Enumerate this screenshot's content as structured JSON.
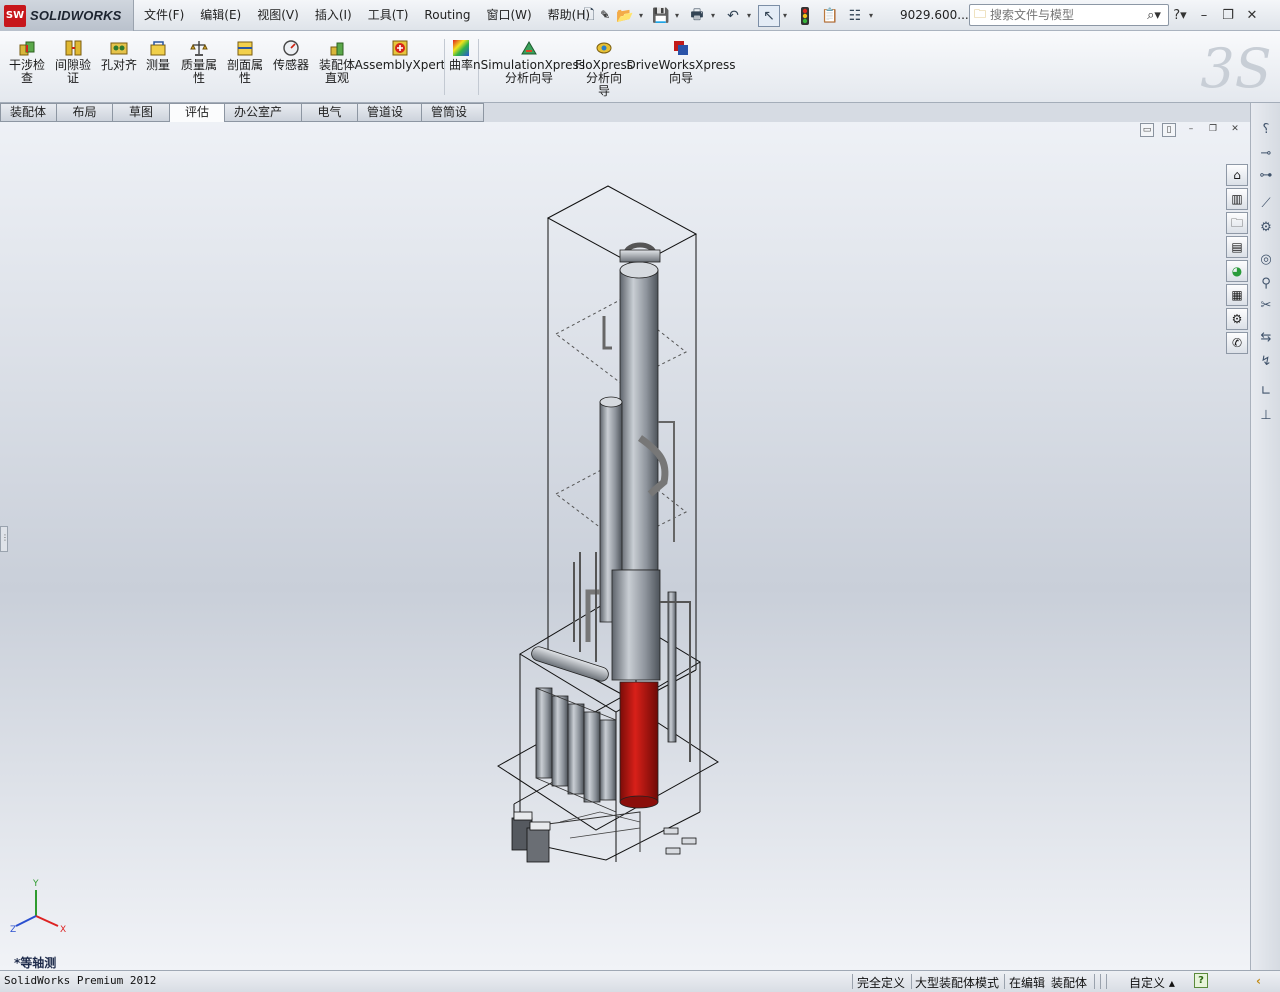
{
  "app": {
    "brand": "SOLIDWORKS",
    "brand_badge": "SW",
    "file_label": "9029.600...",
    "status_product": "SolidWorks Premium 2012"
  },
  "menu": [
    "文件(F)",
    "编辑(E)",
    "视图(V)",
    "插入(I)",
    "工具(T)",
    "Routing",
    "窗口(W)",
    "帮助(H)"
  ],
  "search": {
    "placeholder": "搜索文件与模型"
  },
  "ribbon": {
    "buttons": [
      {
        "label": "干涉检\n查",
        "icon": "interference-check-icon"
      },
      {
        "label": "间隙验\n证",
        "icon": "clearance-verification-icon"
      },
      {
        "label": "孔对齐",
        "icon": "hole-alignment-icon"
      },
      {
        "label": "测量",
        "icon": "measure-icon"
      },
      {
        "label": "质量属\n性",
        "icon": "mass-properties-icon"
      },
      {
        "label": "剖面属\n性",
        "icon": "section-properties-icon"
      },
      {
        "label": "传感器",
        "icon": "sensor-icon"
      },
      {
        "label": "装配体\n直观",
        "icon": "assembly-visualization-icon"
      },
      {
        "label": "AssemblyXpert",
        "icon": "assemblyxpert-icon"
      },
      {
        "label": "曲率",
        "icon": "curvature-icon"
      },
      {
        "label": "nSimulationXpress\n分析向导",
        "icon": "simulationxpress-icon"
      },
      {
        "label": "FloXpress\n分析向\n导",
        "icon": "floxpress-icon"
      },
      {
        "label": "DriveWorksXpress\n向导",
        "icon": "driveworksxpress-icon"
      }
    ]
  },
  "tabs": [
    {
      "label": "装配体",
      "active": false
    },
    {
      "label": "布局",
      "active": false
    },
    {
      "label": "草图",
      "active": false
    },
    {
      "label": "评估",
      "active": true
    },
    {
      "label": "办公室产品",
      "active": false
    },
    {
      "label": "电气",
      "active": false
    },
    {
      "label": "管道设计",
      "active": false
    },
    {
      "label": "管筒设计",
      "active": false
    }
  ],
  "viewport": {
    "view_name": "*等轴测",
    "triad_labels": {
      "x": "X",
      "y": "Y",
      "z": "Z"
    }
  },
  "status": {
    "items": [
      "完全定义",
      "大型装配体模式",
      "在编辑",
      "装配体",
      "自定义"
    ]
  },
  "colors": {
    "accent_red": "#c7161b",
    "model_red": "#b8140f",
    "model_gray": "#7f858d"
  }
}
